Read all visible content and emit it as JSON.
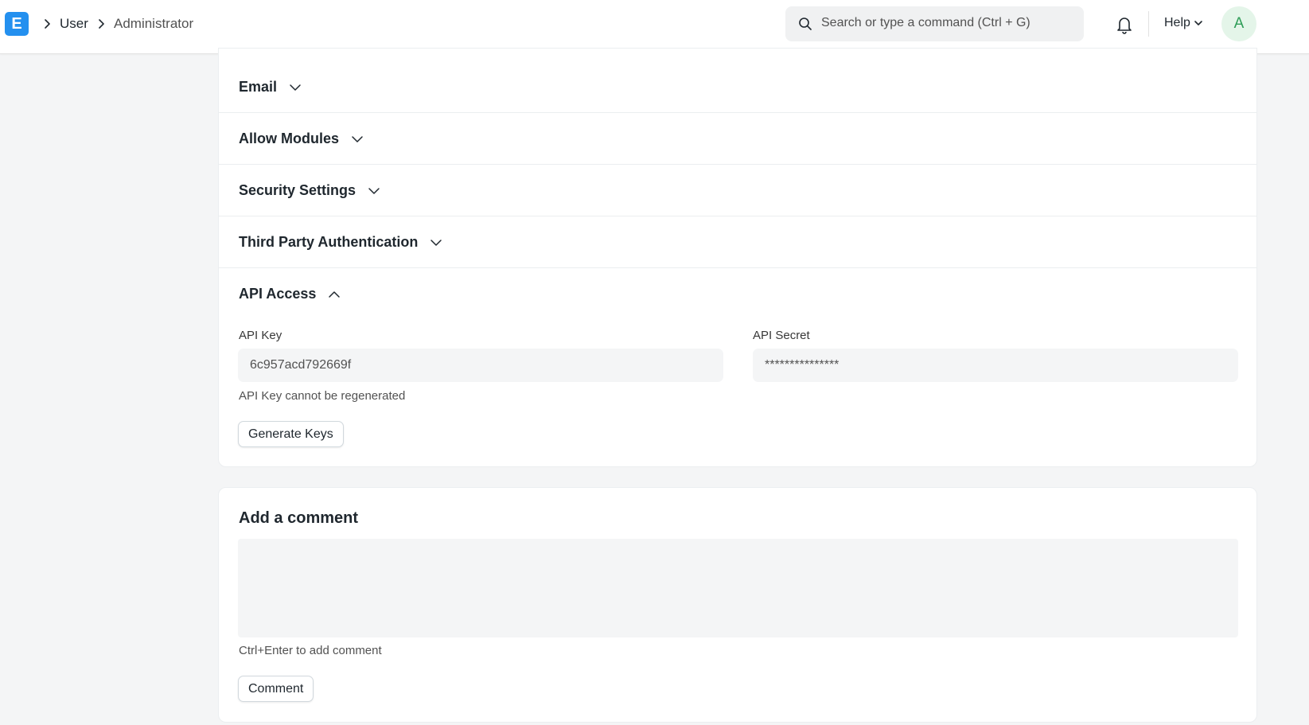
{
  "navbar": {
    "breadcrumbs": [
      "User",
      "Administrator"
    ],
    "search_placeholder": "Search or type a command (Ctrl + G)",
    "help_label": "Help",
    "avatar_initial": "A",
    "logo_letter": "E"
  },
  "form": {
    "sections": [
      {
        "label": "Email",
        "expanded": false
      },
      {
        "label": "Allow Modules",
        "expanded": false
      },
      {
        "label": "Security Settings",
        "expanded": false
      },
      {
        "label": "Third Party Authentication",
        "expanded": false
      },
      {
        "label": "API Access",
        "expanded": true
      }
    ],
    "api_key": {
      "label": "API Key",
      "value": "6c957acd792669f",
      "help": "API Key cannot be regenerated"
    },
    "api_secret": {
      "label": "API Secret",
      "value": "***************"
    },
    "generate_keys_label": "Generate Keys"
  },
  "comment": {
    "title": "Add a comment",
    "hint": "Ctrl+Enter to add comment",
    "button_label": "Comment"
  },
  "colors": {
    "brand": "#2490ef",
    "avatar_bg": "#e4f5e9",
    "avatar_fg": "#2f9d58"
  }
}
